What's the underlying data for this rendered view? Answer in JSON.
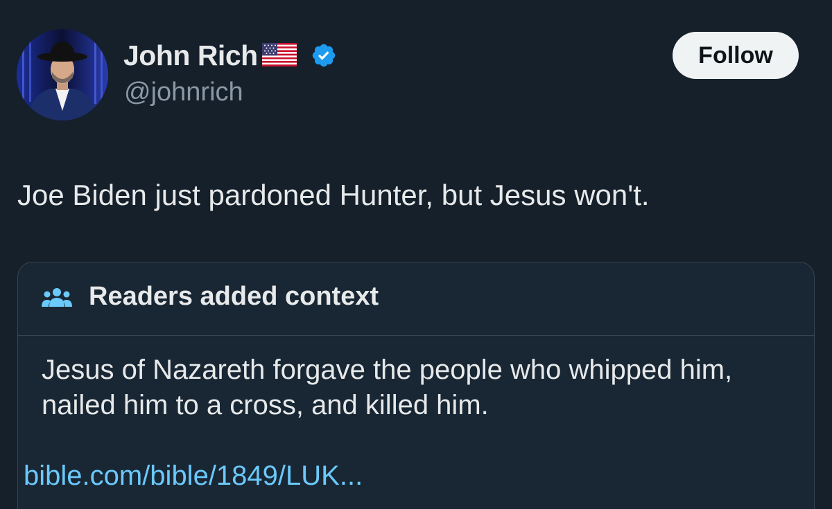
{
  "author": {
    "display_name": "John Rich",
    "handle": "@johnrich",
    "flag_icon": "us-flag-emoji",
    "verified_icon": "verified-badge-icon",
    "verified_color": "#1d9bf0"
  },
  "follow_button": {
    "label": "Follow"
  },
  "tweet": {
    "text": "Joe Biden just pardoned Hunter, but Jesus won't."
  },
  "context": {
    "icon": "readers-people-icon",
    "title": "Readers added context",
    "body": "Jesus of Nazareth forgave the people who whipped him, nailed him to a cross, and killed him.",
    "link": "bible.com/bible/1849/LUK..."
  },
  "colors": {
    "background": "#15202b",
    "card_background": "#192734",
    "text": "#e7e9ea",
    "secondary_text": "#8b98a5",
    "link": "#6bc9fb",
    "border": "#38444d"
  }
}
